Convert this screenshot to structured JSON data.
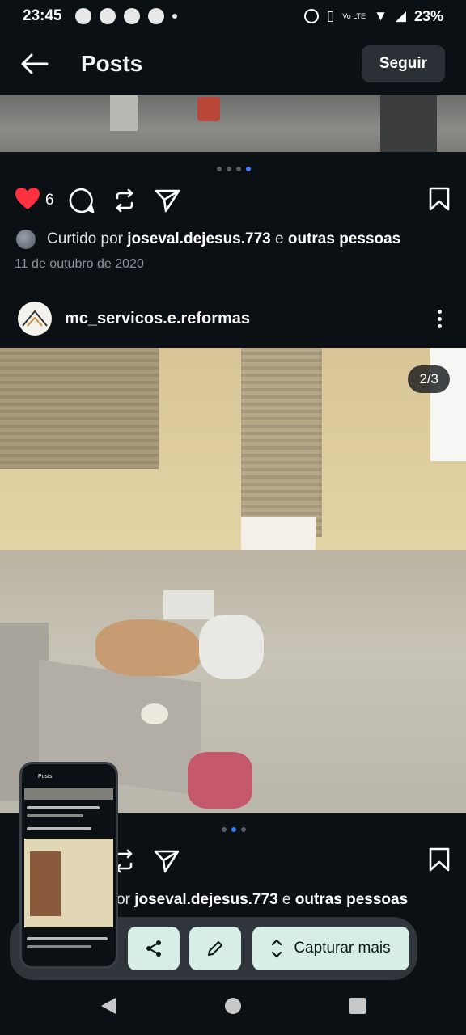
{
  "status_bar": {
    "time": "23:45",
    "network": "Vo LTE",
    "battery": "23%"
  },
  "header": {
    "title": "Posts",
    "follow_label": "Seguir"
  },
  "post1": {
    "like_count": "6",
    "liked_by_prefix": "Curtido por ",
    "liked_by_user": "joseval.dejesus.773",
    "liked_by_conj": " e ",
    "liked_by_others": "outras pessoas",
    "date": "11 de outubro de 2020",
    "carousel_dots": 4,
    "carousel_active": 4
  },
  "post2": {
    "username": "mc_servicos.e.reformas",
    "counter": "2/3",
    "carousel_dots": 3,
    "carousel_active": 2,
    "liked_by_prefix": "or ",
    "liked_by_user": "joseval.dejesus.773",
    "liked_by_conj": " e ",
    "liked_by_others": "outras pessoas"
  },
  "screenshot_toolbar": {
    "capture_more_label": "Capturar mais",
    "thumbnail_title": "Posts"
  },
  "colors": {
    "background": "#0b1014",
    "like_red": "#ff3040",
    "active_dot": "#3d7bff",
    "toolbar_button": "#d6eee5"
  }
}
